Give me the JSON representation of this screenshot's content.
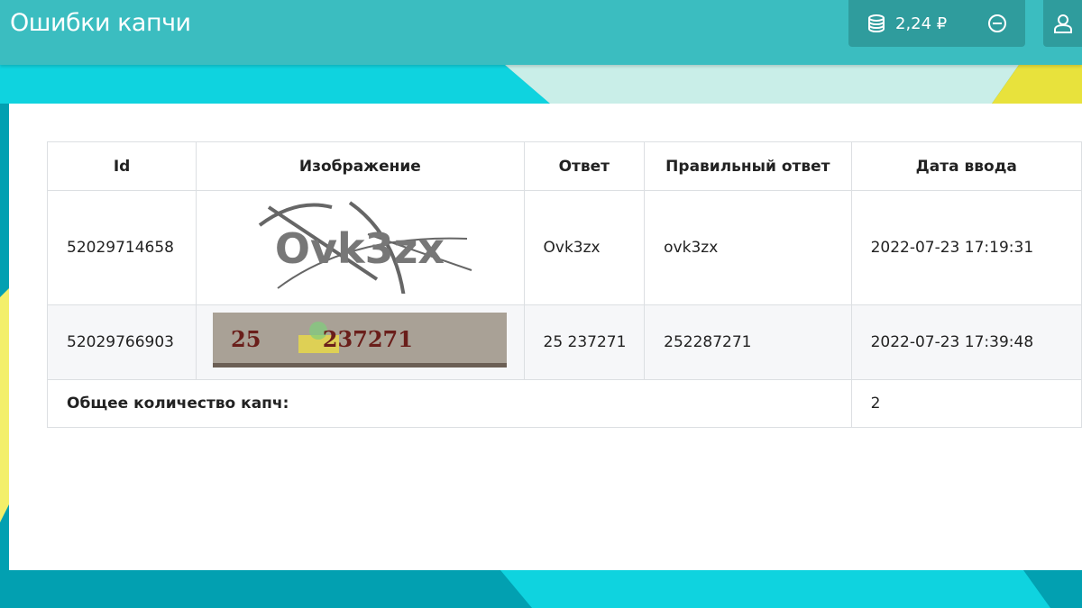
{
  "header": {
    "title": "Ошибки капчи",
    "balance": "2,24 ₽",
    "icons": {
      "balance": "coins-icon",
      "withdraw": "minus-circle-icon",
      "user": "user-icon"
    }
  },
  "colors": {
    "header": "#3bbdc0",
    "button": "#2f9c9d",
    "accent_cyan": "#0fd3df",
    "accent_mint": "#c9eee8",
    "accent_yellow": "#e8e23c"
  },
  "table": {
    "columns": [
      "Id",
      "Изображение",
      "Ответ",
      "Правильный ответ",
      "Дата ввода"
    ],
    "rows": [
      {
        "id": "52029714658",
        "image_text": "Ovk3zx",
        "answer": "Ovk3zx",
        "correct": "ovk3zx",
        "date": "2022-07-23 17:19:31"
      },
      {
        "id": "52029766903",
        "image_text": "25 237271",
        "answer": "25 237271",
        "correct": "252287271",
        "date": "2022-07-23 17:39:48"
      }
    ],
    "total_label": "Общее количество капч:",
    "total_value": "2"
  }
}
